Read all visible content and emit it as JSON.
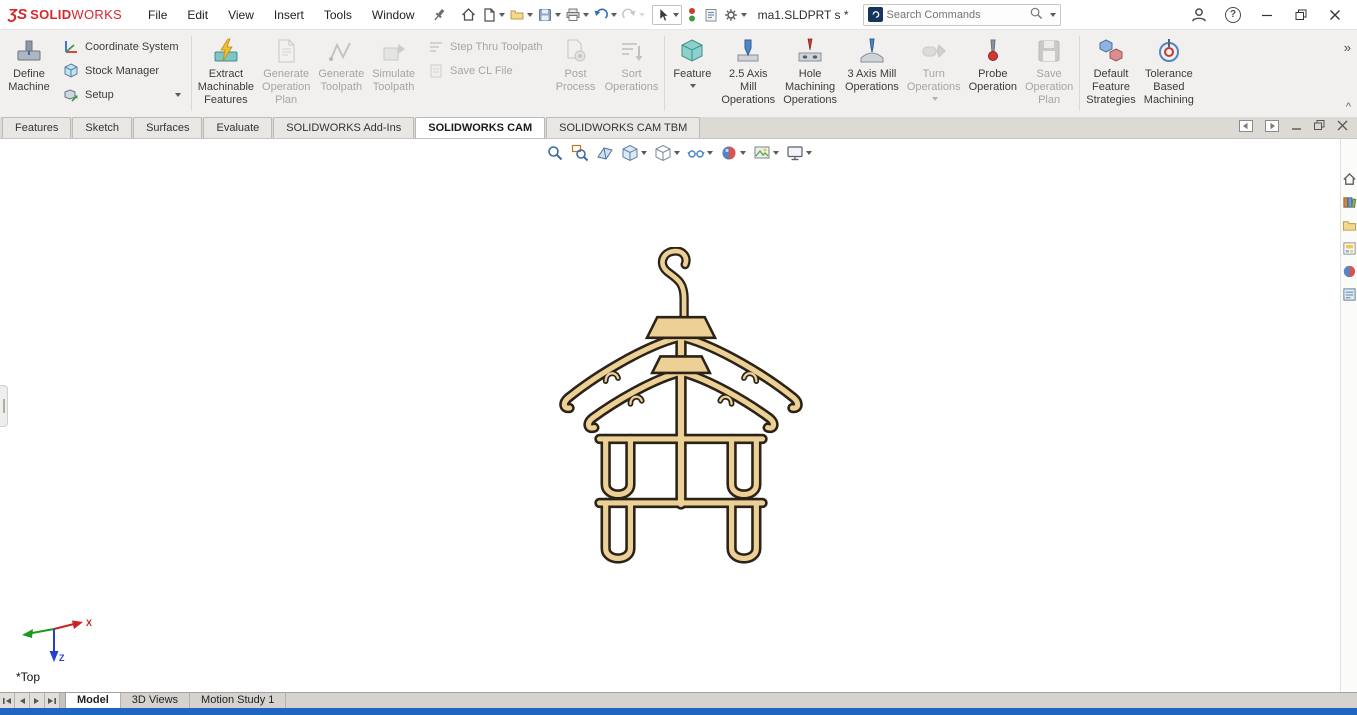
{
  "colors": {
    "accent_red": "#d8262b",
    "statusbar_blue": "#1e66c0",
    "ribbon_bg": "#f1f0ee",
    "tab_active_bg": "#ffffff",
    "disabled_text": "#a8a5a0",
    "model_fill": "#ecd096",
    "model_outline": "#2b2317"
  },
  "titlebar": {
    "brand_mark": "ƷS",
    "brand_bold": "SOLID",
    "brand_light": "WORKS",
    "menus": [
      "File",
      "Edit",
      "View",
      "Insert",
      "Tools",
      "Window"
    ],
    "document_title": "ma1.SLDPRT s *",
    "search": {
      "placeholder": "Search Commands"
    }
  },
  "ribbon": {
    "define_machine": "Define\nMachine",
    "coordinate_system": "Coordinate System",
    "stock_manager": "Stock Manager",
    "setup": "Setup",
    "extract": "Extract\nMachinable\nFeatures",
    "generate_plan": "Generate\nOperation\nPlan",
    "generate_toolpath": "Generate\nToolpath",
    "simulate_toolpath": "Simulate\nToolpath",
    "step_thru": "Step Thru Toolpath",
    "save_cl": "Save CL File",
    "post_process": "Post\nProcess",
    "sort_operations": "Sort\nOperations",
    "feature": "Feature",
    "mill_25": "2.5 Axis\nMill\nOperations",
    "hole_machining": "Hole\nMachining\nOperations",
    "mill_3": "3 Axis Mill\nOperations",
    "turn": "Turn\nOperations",
    "probe": "Probe\nOperation",
    "save_plan": "Save\nOperation\nPlan",
    "default_strategies": "Default\nFeature\nStrategies",
    "tbm": "Tolerance\nBased\nMachining",
    "overflow_glyph": "»",
    "collapse_glyph": "^"
  },
  "tabs": {
    "items": [
      "Features",
      "Sketch",
      "Surfaces",
      "Evaluate",
      "SOLIDWORKS Add-Ins",
      "SOLIDWORKS CAM",
      "SOLIDWORKS CAM TBM"
    ],
    "active": "SOLIDWORKS CAM"
  },
  "viewport": {
    "orientation_label": "*Top",
    "triad": {
      "x": "X",
      "z": "Z"
    }
  },
  "bottom_bar": {
    "tabs": [
      "Model",
      "3D Views",
      "Motion Study 1"
    ],
    "active": "Model"
  },
  "icons": {
    "help": "?",
    "pin": "pushpin",
    "home": "house",
    "new_document": "blank-page",
    "open": "folder",
    "save": "floppy-disk",
    "print": "printer",
    "undo": "arrow-curve-left",
    "redo": "arrow-curve-right",
    "select": "cursor-arrow",
    "stoplight": "red-green-dots",
    "clipboard": "list-panel",
    "options": "gear",
    "search": "magnifier",
    "user": "person-silhouette",
    "minimize": "line",
    "restore": "overlapping-squares",
    "close": "x-cross",
    "zoom_fit": "magnifier",
    "zoom_area": "magnifier-box",
    "section_view": "cut-plane",
    "view_orientation": "cube",
    "display_style": "cube-wireframe",
    "hide_show": "glasses",
    "edit_appearance": "color-ball",
    "apply_scene": "scene-ball",
    "view_settings": "monitor",
    "taskpane_resources": "house",
    "design_library": "books",
    "file_explorer": "folder",
    "view_palette": "palette-window",
    "appearances": "sphere",
    "custom_properties": "form-panel"
  }
}
